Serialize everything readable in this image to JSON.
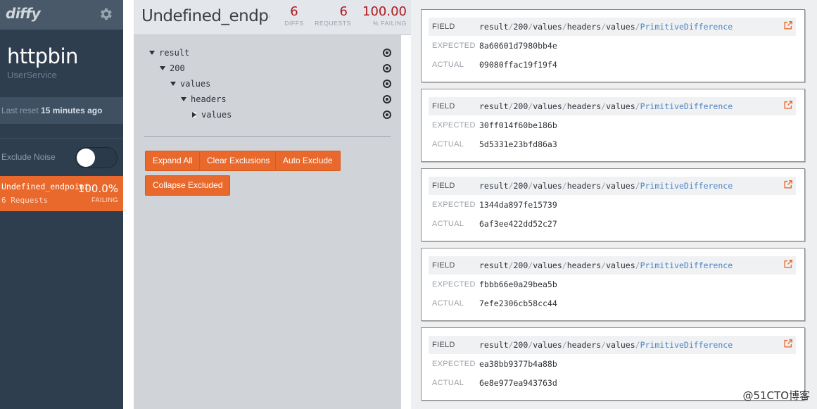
{
  "sidebar": {
    "logo": "diffy",
    "service_name": "httpbin",
    "service_sub": "UserService",
    "last_reset_label": "Last reset",
    "last_reset_value": "15 minutes ago",
    "exclude_noise_label": "Exclude Noise",
    "exclude_noise_on": false,
    "endpoint": {
      "name": "Undefined_endpoint",
      "requests": "6 Requests",
      "percent": "100.0%",
      "status": "FAILING"
    }
  },
  "middle": {
    "title": "Undefined_endpoint",
    "stats": [
      {
        "value": "6",
        "label": "DIFFS"
      },
      {
        "value": "6",
        "label": "REQUESTS"
      },
      {
        "value": "100.00",
        "label": "% FAILING"
      }
    ],
    "tree": [
      {
        "label": "result",
        "expanded": true
      },
      {
        "label": "200",
        "expanded": true
      },
      {
        "label": "values",
        "expanded": true
      },
      {
        "label": "headers",
        "expanded": true
      },
      {
        "label": "values",
        "expanded": false
      }
    ],
    "buttons": {
      "expand_all": "Expand All",
      "clear_exclusions": "Clear Exclusions",
      "auto_exclude": "Auto Exclude",
      "collapse_excluded": "Collapse Excluded"
    }
  },
  "diffs": {
    "field_label": "FIELD",
    "expected_label": "EXPECTED",
    "actual_label": "ACTUAL",
    "path": [
      "result",
      "200",
      "values",
      "headers",
      "values"
    ],
    "diff_type": "PrimitiveDifference",
    "items": [
      {
        "expected": "8a60601d7980bb4e",
        "actual": "09080ffac19f19f4"
      },
      {
        "expected": "30ff014f60be186b",
        "actual": "5d5331e23bfd86a3"
      },
      {
        "expected": "1344da897fe15739",
        "actual": "6af3ee422dd52c27"
      },
      {
        "expected": "fbbb66e0a29bea5b",
        "actual": "7efe2306cb58cc44"
      },
      {
        "expected": "ea38bb9377b4a88b",
        "actual": "6e8e977ea943763d"
      }
    ]
  },
  "watermark": "@51CTO博客",
  "colors": {
    "accent": "#e8692b",
    "sidebar_bg": "#2f3e4e",
    "stat_red": "#b0181e",
    "link_blue": "#4f84c4"
  }
}
